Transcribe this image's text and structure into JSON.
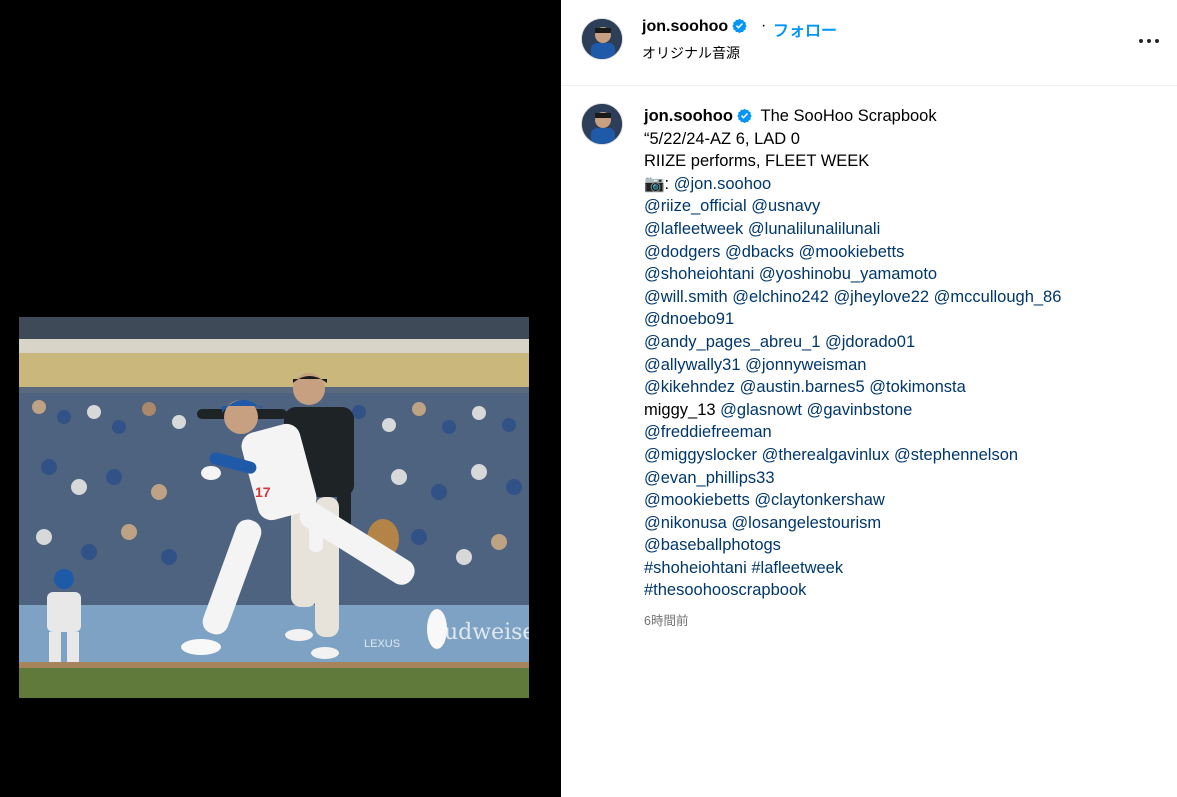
{
  "header": {
    "username": "jon.soohoo",
    "separator": "·",
    "follow_label": "フォロー",
    "audio_label": "オリジナル音源"
  },
  "caption": {
    "username": "jon.soohoo",
    "title": "The SooHoo Scrapbook",
    "lines": [
      "“5/22/24-AZ 6, LAD 0",
      "RIIZE performs, FLEET WEEK",
      "📷: @jon.soohoo",
      "@riize_official @usnavy",
      "@lafleetweek @lunalilunalilunali",
      "@dodgers @dbacks @mookiebetts",
      "@shoheiohtani @yoshinobu_yamamoto",
      "@will.smith @elchino242 @jheylove22 @mccullough_86",
      "@dnoebo91",
      "@andy_pages_abreu_1 @jdorado01",
      "@allywally31 @jonnyweisman",
      "@kikehndez @austin.barnes5 @tokimonsta",
      "miggy_13 @glasnowt @gavinbstone",
      "@freddiefreeman",
      "@miggyslocker @therealgavinlux @stephennelson",
      "@evan_phillips33",
      "@mookiebetts @claytonkershaw",
      "@nikonusa @losangelestourism",
      "@baseballphotogs",
      "#shoheiohtani #lafleetweek",
      "#thesoohooscrapbook"
    ],
    "timestamp": "6時間前"
  },
  "media": {
    "ad_text": "udweiser",
    "ad_text_2": "LEXUS",
    "jersey_number": "17"
  },
  "colors": {
    "follow": "#0095f6",
    "verified": "#0095f6",
    "link": "#00376b",
    "muted": "#737373",
    "dodger_blue": "#1e5aa8"
  }
}
